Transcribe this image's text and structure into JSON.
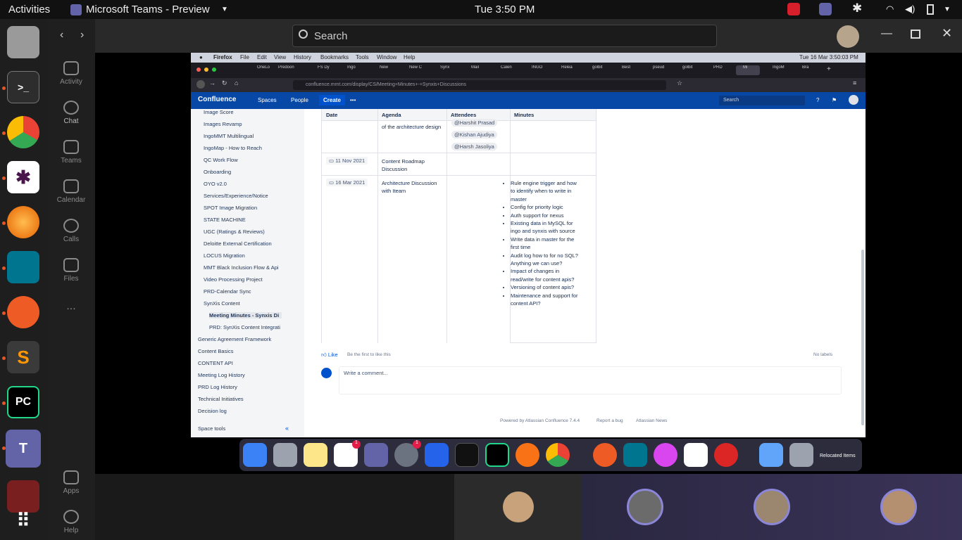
{
  "system_bar": {
    "activities": "Activities",
    "app_title": "Microsoft Teams - Preview",
    "clock": "Tue  3:50 PM"
  },
  "teams": {
    "search_placeholder": "Search",
    "rail": [
      {
        "label": "Activity",
        "icon": "bell-icon"
      },
      {
        "label": "Chat",
        "icon": "chat-icon"
      },
      {
        "label": "Teams",
        "icon": "teams-icon"
      },
      {
        "label": "Calendar",
        "icon": "calendar-icon"
      },
      {
        "label": "Calls",
        "icon": "phone-icon"
      },
      {
        "label": "Files",
        "icon": "file-icon"
      },
      {
        "label": "Apps",
        "icon": "apps-icon"
      },
      {
        "label": "Help",
        "icon": "help-icon"
      }
    ],
    "more": "..."
  },
  "mac_menu": {
    "apple": "",
    "app": "Firefox",
    "items": [
      "File",
      "Edit",
      "View",
      "History",
      "Bookmarks",
      "Tools",
      "Window",
      "Help"
    ],
    "clock": "Tue 16 Mar  3:50:03 PM"
  },
  "browser": {
    "tabs": [
      "OneLo",
      "Predoon",
      "FS Dy",
      "Ingo",
      "New",
      "New C",
      "Synx",
      "Mail",
      "Calen",
      "INGO",
      "Relea",
      "golbit",
      "Best",
      "pseud",
      "golbit",
      "PRD",
      "Mi",
      "IngoM",
      "Bra"
    ],
    "url": "confluence.mmt.com/display/CS/Meeting+Minutes+-+Synxis+Discussions"
  },
  "confluence": {
    "logo": "Confluence",
    "nav": {
      "spaces": "Spaces",
      "people": "People",
      "create": "Create",
      "search": "Search"
    },
    "sidebar": [
      {
        "label": "Image Score",
        "level": "item"
      },
      {
        "label": "Images Revamp",
        "level": "item"
      },
      {
        "label": "IngoMMT Multilingual",
        "level": "item"
      },
      {
        "label": "IngoMap - How to Reach",
        "level": "item"
      },
      {
        "label": "QC Work Flow",
        "level": "item"
      },
      {
        "label": "Onboarding",
        "level": "item"
      },
      {
        "label": "OYO v2.0",
        "level": "item"
      },
      {
        "label": "Services/Experience/Notice",
        "level": "item"
      },
      {
        "label": "SPOT Image Migration",
        "level": "item"
      },
      {
        "label": "STATE MACHINE",
        "level": "item"
      },
      {
        "label": "UGC (Ratings & Reviews)",
        "level": "item"
      },
      {
        "label": "Deloitte External Certification",
        "level": "item"
      },
      {
        "label": "LOCUS Migration",
        "level": "item"
      },
      {
        "label": "MMT Black Inclusion Flow & Api",
        "level": "item"
      },
      {
        "label": "Video Processing Project",
        "level": "item"
      },
      {
        "label": "PRD-Calendar Sync",
        "level": "item"
      },
      {
        "label": "SynXis Content",
        "level": "item"
      },
      {
        "label": "Meeting Minutes - Synxis Di",
        "level": "current"
      },
      {
        "label": "PRD: SynXis Content Integrati",
        "level": "sub"
      },
      {
        "label": "Generic Agreement Framework",
        "level": "top"
      },
      {
        "label": "Content Basics",
        "level": "top"
      },
      {
        "label": "CONTENT API",
        "level": "top"
      },
      {
        "label": "Meeting Log History",
        "level": "top"
      },
      {
        "label": "PRD Log History",
        "level": "top"
      },
      {
        "label": "Technical Initiatives",
        "level": "top"
      },
      {
        "label": "Decision log",
        "level": "top"
      }
    ],
    "space_tools": "Space tools",
    "table": {
      "headers": [
        "Date",
        "Agenda",
        "Attendees",
        "Minutes"
      ],
      "rows": [
        {
          "date": "",
          "agenda": "of the architecture design",
          "attendees": [
            "@Harshit Prasad",
            "@Kishan Ajudiya",
            "@Harsh Jasoliya"
          ]
        },
        {
          "date": "11 Nov 2021",
          "agenda": "Content Roadmap Discussion",
          "attendees": []
        },
        {
          "date": "16 Mar 2021",
          "agenda": "Architecture Discussion with Iteam",
          "attendees": [],
          "minutes": [
            "Rule engine trigger and how to identify when to write in master",
            "Config for priority logic",
            "Auth support for nexus",
            "Existing data in MySQL for ingo and synxis with source",
            "Write data in master for the first time",
            "Audit log how to for no SQL? Anything we can use?",
            "Impact of changes in read/write for content apis?",
            "Versioning of content apis?",
            "Maintenance and support for content API?"
          ]
        }
      ]
    },
    "like": "Like",
    "be_first": "Be the first to like this",
    "no_labels": "No labels",
    "comment_placeholder": "Write a comment...",
    "footer": {
      "powered": "Powered by Atlassian Confluence 7.4.4",
      "report": "Report a bug",
      "news": "Atlassian News"
    }
  },
  "dock_badges": {
    "slack": "1",
    "settings": "1"
  },
  "relocated": "Relocated Items",
  "colors": {
    "confluence_blue": "#0747a6",
    "teams_purple": "#6264a7",
    "ubuntu_orange": "#e95420"
  }
}
